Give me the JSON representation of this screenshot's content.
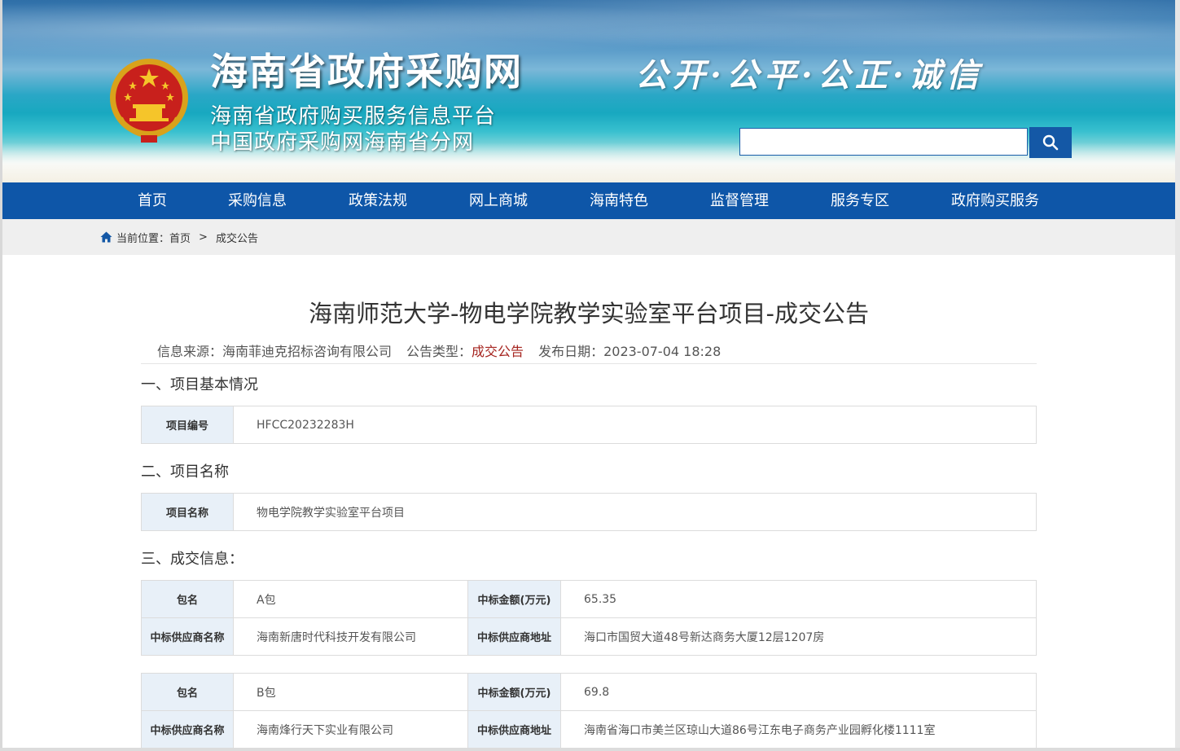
{
  "header": {
    "site_title": "海南省政府采购网",
    "subtitle_1": "海南省政府购买服务信息平台",
    "subtitle_2": "中国政府采购网海南省分网",
    "slogan": "公开·公平·公正·诚信",
    "search": {
      "value": "",
      "placeholder": ""
    },
    "search_icon": "search-icon",
    "emblem_icon": "national-emblem-icon"
  },
  "nav": {
    "items": [
      {
        "label": "首页"
      },
      {
        "label": "采购信息"
      },
      {
        "label": "政策法规"
      },
      {
        "label": "网上商城"
      },
      {
        "label": "海南特色"
      },
      {
        "label": "监督管理"
      },
      {
        "label": "服务专区"
      },
      {
        "label": "政府购买服务"
      }
    ],
    "color": "#0e56a8"
  },
  "breadcrumb": {
    "icon": "home-icon",
    "prefix": "当前位置：",
    "items": [
      {
        "label": "首页"
      },
      {
        "label": "成交公告"
      }
    ],
    "separator": ">"
  },
  "article": {
    "title": "海南师范大学-物电学院教学实验室平台项目-成交公告",
    "meta": {
      "source_label": "信息来源：",
      "source_value": "海南菲迪克招标咨询有限公司",
      "type_label": "公告类型：",
      "type_value": "成交公告",
      "date_label": "发布日期：",
      "date_value": "2023-07-04 18:28"
    },
    "sections": [
      {
        "heading": "一、项目基本情况",
        "rows": [
          {
            "key": "项目编号",
            "value": "HFCC20232283H"
          }
        ]
      },
      {
        "heading": "二、项目名称",
        "rows": [
          {
            "key": "项目名称",
            "value": "物电学院教学实验室平台项目"
          }
        ]
      },
      {
        "heading": "三、成交信息：",
        "packages": [
          {
            "pkg_key": "包名",
            "pkg_value": "A包",
            "amount_key": "中标金额(万元)",
            "amount_value": "65.35",
            "supplier_key": "中标供应商名称",
            "supplier_value": "海南新唐时代科技开发有限公司",
            "address_key": "中标供应商地址",
            "address_value": "海口市国贸大道48号新达商务大厦12层1207房"
          },
          {
            "pkg_key": "包名",
            "pkg_value": "B包",
            "amount_key": "中标金额(万元)",
            "amount_value": "69.8",
            "supplier_key": "中标供应商名称",
            "supplier_value": "海南烽行天下实业有限公司",
            "address_key": "中标供应商地址",
            "address_value": "海南省海口市美兰区琼山大道86号江东电子商务产业园孵化楼1111室"
          }
        ]
      }
    ]
  },
  "colors": {
    "nav_blue": "#0e56a8",
    "type_red": "#a5231e",
    "key_cell_bg": "#e8f0f8"
  }
}
